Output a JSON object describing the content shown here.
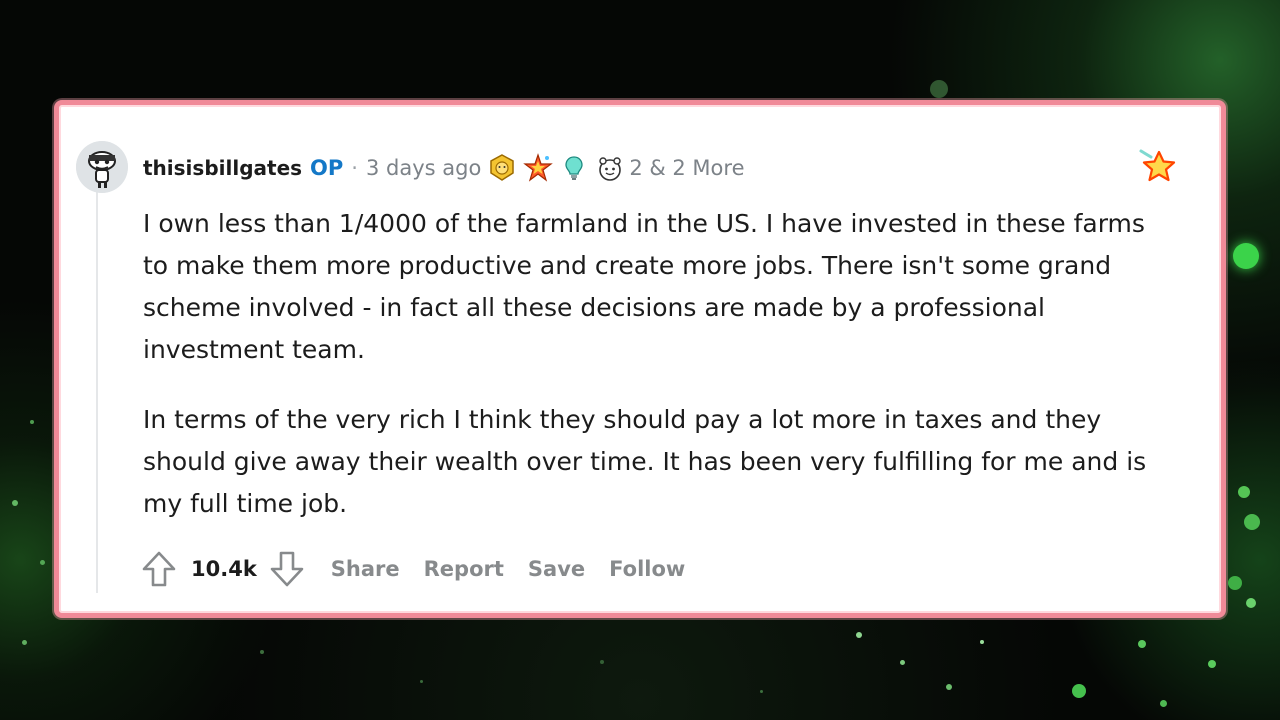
{
  "comment": {
    "author": "thisisbillgates",
    "op_badge": "OP",
    "separator": "·",
    "time": "3 days ago",
    "awards_more": "2 & 2 More",
    "paragraphs": [
      "I own less than 1/4000 of the farmland in the US. I have invested in these farms to make them more productive and create more jobs. There isn't some grand scheme involved - in fact all these decisions are made by a professional investment team.",
      "In terms of the very rich I think they should pay a lot more in taxes and they should give away their wealth over time. It has been very fulfilling for me and is my full time job."
    ],
    "score": "10.4k",
    "actions": {
      "share": "Share",
      "report": "Report",
      "save": "Save",
      "follow": "Follow"
    }
  },
  "colors": {
    "card_border": "#f08a98",
    "op_blue": "#1478c7",
    "meta_gray": "#7c8288",
    "background": "#050705"
  },
  "icons": [
    "avatar",
    "gold-award-icon",
    "star-burst-award-icon",
    "lightbulb-award-icon",
    "wholesome-award-icon",
    "favorite-star-icon",
    "upvote-icon",
    "downvote-icon"
  ]
}
